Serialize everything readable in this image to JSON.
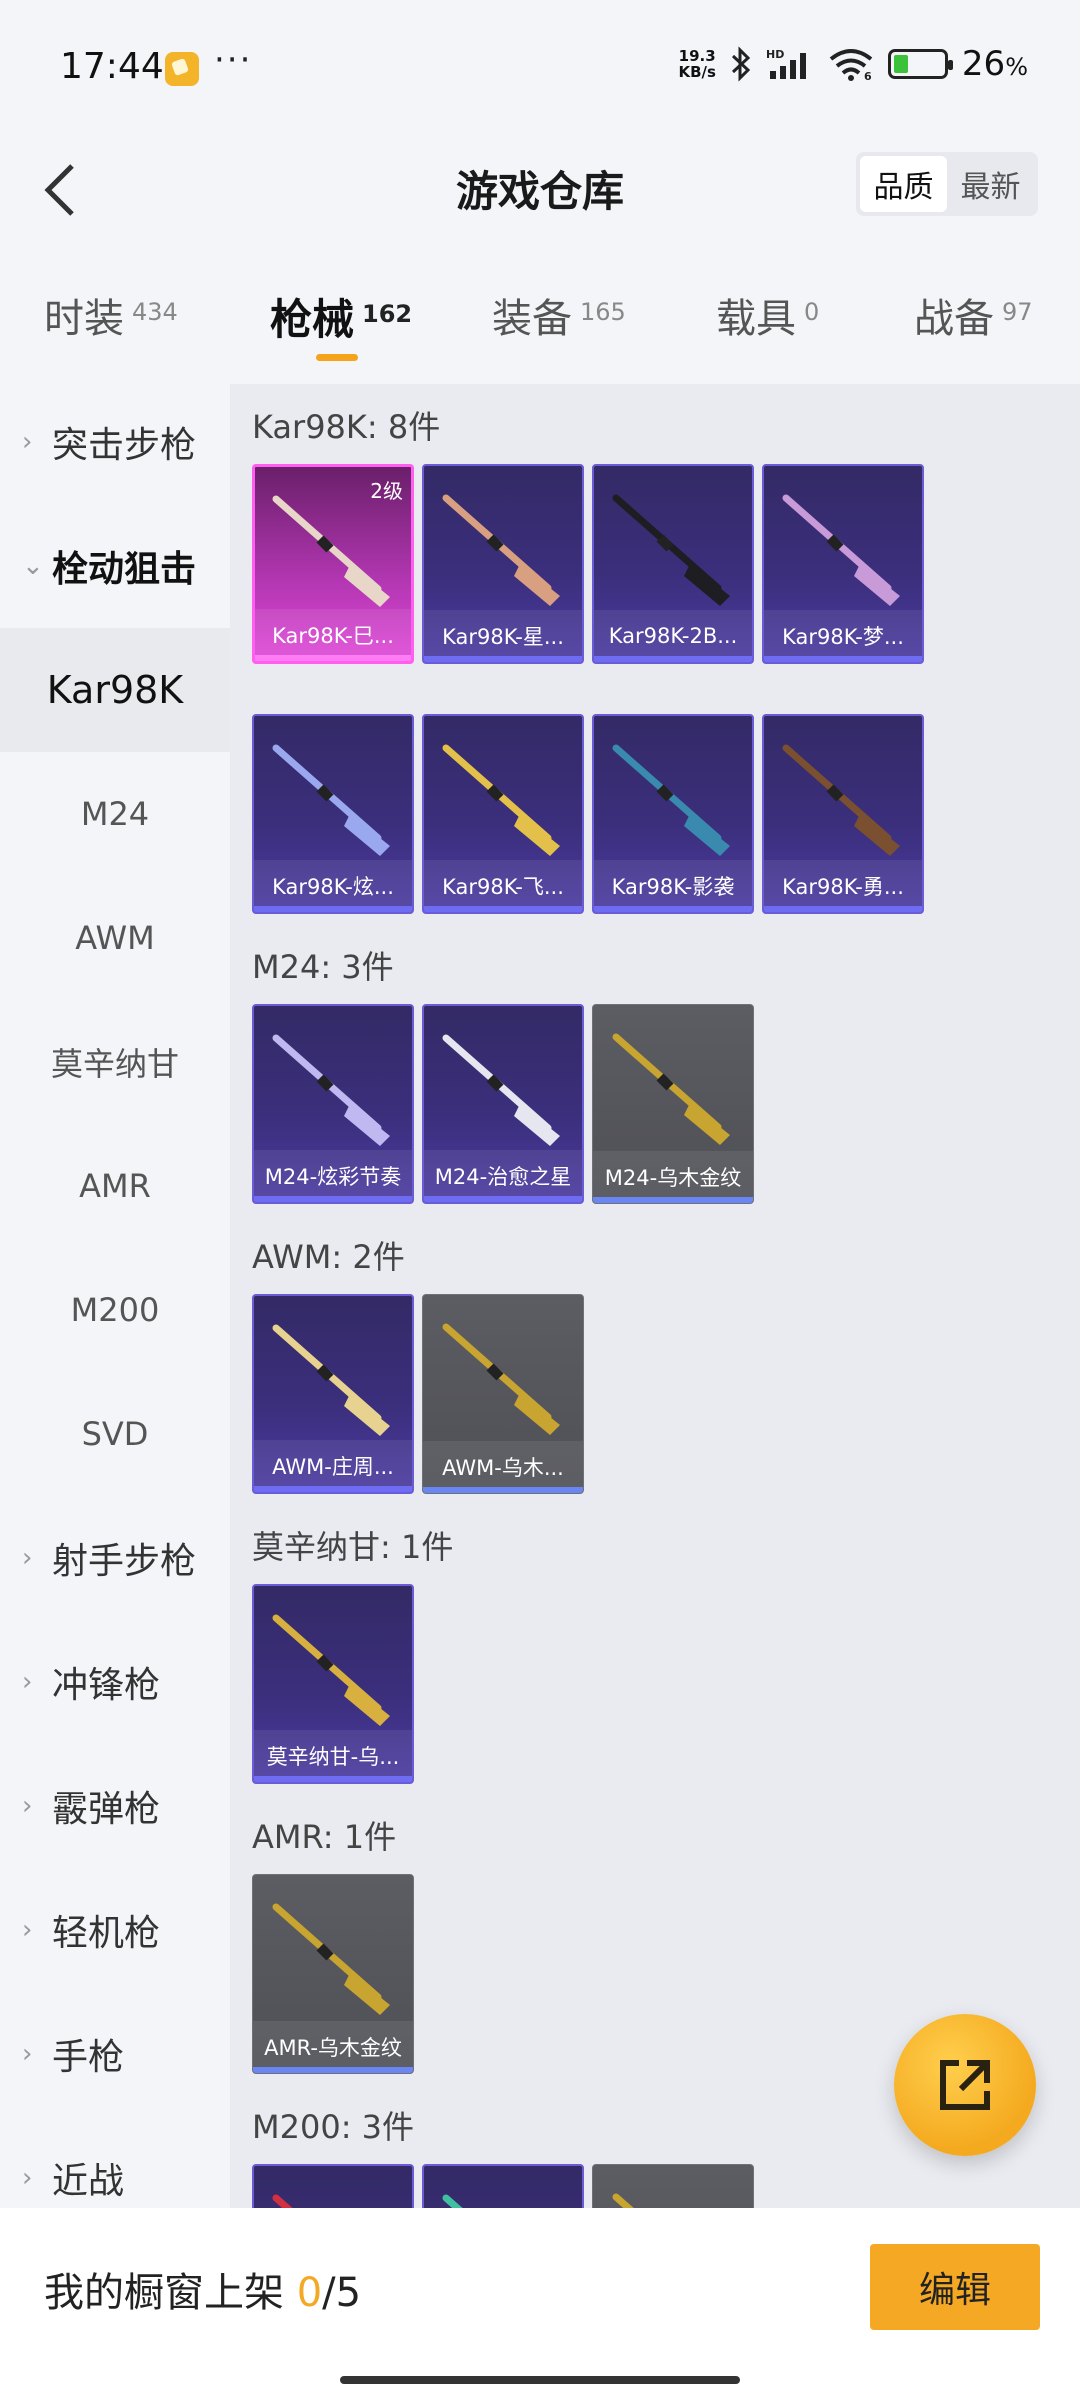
{
  "status": {
    "time": "17:44",
    "dots": "···",
    "net_speed_value": "19.3",
    "net_speed_unit": "KB/s",
    "signal_label": "HD",
    "wifi_label": "6",
    "battery_percent": "26",
    "battery_percent_sign": "%",
    "battery_level": 0.26
  },
  "nav": {
    "title": "游戏仓库",
    "sort_options": [
      "品质",
      "最新"
    ],
    "sort_selected": "品质"
  },
  "tabs": [
    {
      "label": "时装",
      "count": "434"
    },
    {
      "label": "枪械",
      "count": "162",
      "active": true
    },
    {
      "label": "装备",
      "count": "165"
    },
    {
      "label": "载具",
      "count": "0"
    },
    {
      "label": "战备",
      "count": "97"
    }
  ],
  "sidebar": {
    "groups_top": [
      {
        "label": "突击步枪",
        "chevron": "›"
      },
      {
        "label": "栓动狙击",
        "chevron": "⌄",
        "open": true
      }
    ],
    "sub_items": [
      "Kar98K",
      "M24",
      "AWM",
      "莫辛纳甘",
      "AMR",
      "M200",
      "SVD"
    ],
    "sub_active": "Kar98K",
    "groups_bottom": [
      {
        "label": "射手步枪",
        "chevron": "›"
      },
      {
        "label": "冲锋枪",
        "chevron": "›"
      },
      {
        "label": "霰弹枪",
        "chevron": "›"
      },
      {
        "label": "轻机枪",
        "chevron": "›"
      },
      {
        "label": "手枪",
        "chevron": "›"
      },
      {
        "label": "近战",
        "chevron": "›"
      }
    ]
  },
  "sections": [
    {
      "title": "Kar98K: 8件",
      "items": [
        {
          "name": "Kar98K-巳...",
          "rarity": "pink",
          "badge": "2级",
          "gun_color": "#e8d6c8"
        },
        {
          "name": "Kar98K-星...",
          "rarity": "purple",
          "gun_color": "#d8a080"
        },
        {
          "name": "Kar98K-2B...",
          "rarity": "purple",
          "gun_color": "#1d1d22"
        },
        {
          "name": "Kar98K-梦...",
          "rarity": "purple",
          "gun_color": "#c89ad8"
        },
        {
          "name": "Kar98K-炫...",
          "rarity": "purple",
          "gun_color": "#9aa8f0"
        },
        {
          "name": "Kar98K-飞...",
          "rarity": "purple",
          "gun_color": "#e3c04a"
        },
        {
          "name": "Kar98K-影袭",
          "rarity": "purple",
          "gun_color": "#3a8ab0"
        },
        {
          "name": "Kar98K-勇...",
          "rarity": "purple",
          "gun_color": "#7a5030"
        }
      ]
    },
    {
      "title": "M24: 3件",
      "items": [
        {
          "name": "M24-炫彩节奏",
          "rarity": "purple",
          "gun_color": "#c0b8f0"
        },
        {
          "name": "M24-治愈之星",
          "rarity": "purple",
          "gun_color": "#e6e6f0"
        },
        {
          "name": "M24-乌木金纹",
          "rarity": "gray",
          "gun_color": "#c8a430"
        }
      ]
    },
    {
      "title": "AWM: 2件",
      "items": [
        {
          "name": "AWM-庄周...",
          "rarity": "purple",
          "gun_color": "#e8d290"
        },
        {
          "name": "AWM-乌木...",
          "rarity": "gray",
          "gun_color": "#c8a430"
        }
      ]
    },
    {
      "title": "莫辛纳甘: 1件",
      "items": [
        {
          "name": "莫辛纳甘-乌...",
          "rarity": "purple",
          "gun_color": "#d8b040"
        }
      ]
    },
    {
      "title": "AMR: 1件",
      "items": [
        {
          "name": "AMR-乌木金纹",
          "rarity": "gray",
          "gun_color": "#c8a430"
        }
      ]
    },
    {
      "title": "M200: 3件",
      "items": [
        {
          "name": "",
          "rarity": "purple",
          "gun_color": "#d03040"
        },
        {
          "name": "",
          "rarity": "purple",
          "gun_color": "#40c0a0"
        },
        {
          "name": "",
          "rarity": "gray",
          "gun_color": "#c8a430"
        }
      ]
    }
  ],
  "bottom": {
    "label": "我的橱窗上架 ",
    "used": "0",
    "total": "/5",
    "edit_label": "编辑"
  },
  "colors": {
    "accent": "#f5a823",
    "rarity_purple": "#3b2f7c",
    "rarity_pink": "#e04ad8",
    "rarity_gray": "#4f5055"
  }
}
